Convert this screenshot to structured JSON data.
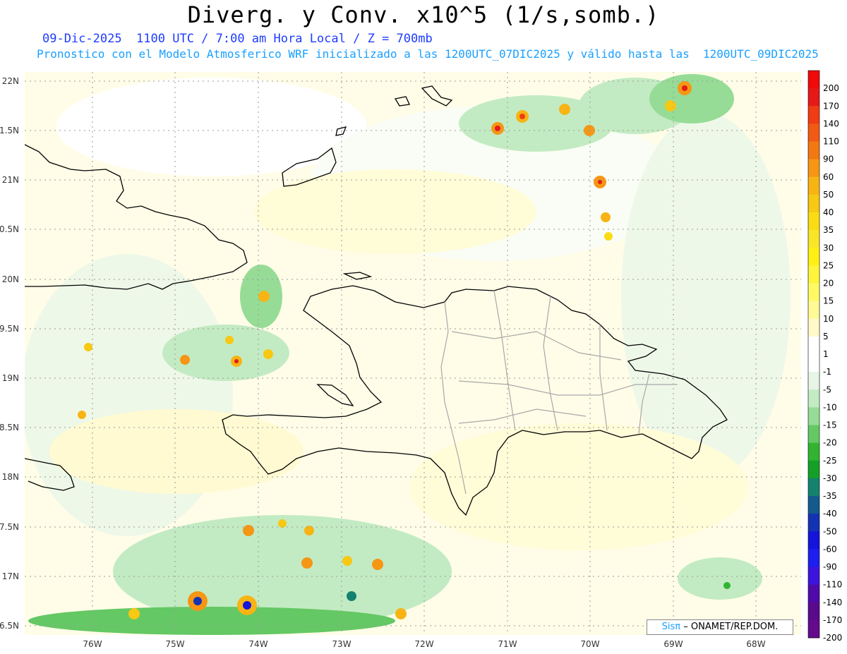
{
  "title": "Diverg. y Conv. x10^5 (1/s,somb.)",
  "subtitle_line1": "09-Dic-2025  1100 UTC / 7:00 am Hora Local / Z = 700mb",
  "subtitle_line2": "Pronostico con el Modelo Atmosferico WRF inicializado a las 1200UTC_07DIC2025 y válido hasta las  1200UTC_09DIC2025",
  "map": {
    "lat_labels": [
      "22N",
      "1.5N",
      "21N",
      "0.5N",
      "20N",
      "9.5N",
      "19N",
      "8.5N",
      "18N",
      "7.5N",
      "17N",
      "6.5N"
    ],
    "lon_labels": [
      "76W",
      "75W",
      "74W",
      "73W",
      "72W",
      "71W",
      "70W",
      "69W",
      "68W"
    ]
  },
  "colorbar": {
    "labels": [
      "200",
      "170",
      "140",
      "110",
      "90",
      "60",
      "50",
      "40",
      "35",
      "30",
      "25",
      "20",
      "15",
      "10",
      "5",
      "1",
      "-1",
      "-5",
      "-10",
      "-15",
      "-20",
      "-25",
      "-30",
      "-35",
      "-40",
      "-50",
      "-60",
      "-90",
      "-110",
      "-140",
      "-170",
      "-200"
    ],
    "colors": [
      "#f00a0a",
      "#e61919",
      "#f03c14",
      "#f05a14",
      "#f27814",
      "#f59614",
      "#f7b414",
      "#f7c814",
      "#fadc14",
      "#fae628",
      "#fff014",
      "#fff53c",
      "#fffa64",
      "#fffa96",
      "#fffac8",
      "#ffffff",
      "#ffffff",
      "#e6f5e6",
      "#c3ebc3",
      "#96dc96",
      "#64c864",
      "#32b432",
      "#14a028",
      "#14826e",
      "#145a8c",
      "#1432b4",
      "#1414dc",
      "#1e1ef0",
      "#3c14dc",
      "#500aaa",
      "#5a0a8c",
      "#640a8c"
    ]
  },
  "credit": {
    "logo": "Sisπ",
    "text": "– ONAMET/REP.DOM."
  }
}
